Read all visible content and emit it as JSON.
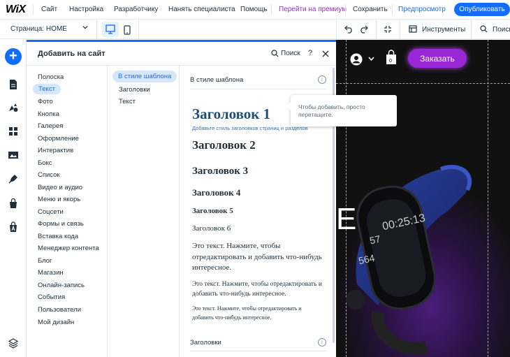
{
  "topbar": {
    "logo": "WiX",
    "nav": [
      "Сайт",
      "Настройка",
      "Разработчику",
      "Нанять специалиста",
      "Помощь"
    ],
    "premium": "Перейти на премиум",
    "save": "Сохранить",
    "preview": "Предпросмотр",
    "publish": "Опубликовать"
  },
  "toolbar2": {
    "page_selector": "Страница: HOME",
    "tools": "Инструменты",
    "search": "Поиск"
  },
  "panel": {
    "title": "Добавить на сайт",
    "search": "Поиск",
    "help": "?",
    "categories": [
      "Полоска",
      "Текст",
      "Фото",
      "Кнопка",
      "Галерея",
      "Оформление",
      "Интерактив",
      "Бокс",
      "Список",
      "Видео и аудио",
      "Меню и якорь",
      "Соцсети",
      "Формы и связь",
      "Вставка кода",
      "Менеджер контента",
      "Блог",
      "Магазин",
      "Онлайн-запись",
      "События",
      "Пользователи",
      "Мой дизайн"
    ],
    "active_category": "Текст",
    "subcategories": [
      "В стиле шаблона",
      "Заголовки",
      "Текст"
    ],
    "active_subcategory": "В стиле шаблона",
    "section_title": "В стиле шаблона",
    "headings": {
      "h1": "Заголовок 1",
      "h1_sub": "Добавьте стиль заголовков страниц и разделов",
      "h2": "Заголовок 2",
      "h3": "Заголовок 3",
      "h4": "Заголовок 4",
      "h5": "Заголовок 5",
      "h6": "Заголовок 6"
    },
    "paragraphs": {
      "p1": "Это текст. Нажмите, чтобы отредактировать и добавить что-нибудь интересное.",
      "p2": "Это текст. Нажмите, чтобы отредактировать и добавить что-нибудь интересное.",
      "p3": "Это текст. Нажмите, чтобы отредактировать и добавить что-нибудь интересное."
    },
    "section2_title": "Заголовки"
  },
  "tooltip": {
    "text": "Чтобы добавить, просто перетащите."
  },
  "canvas": {
    "order_button": "Заказать",
    "cart_count": "0",
    "watch_time": "00:25:13",
    "watch_hr": "57",
    "watch_steps": "564"
  },
  "colors": {
    "accent": "#116dff",
    "premium": "#9a27d5",
    "order": "#9a27d5"
  }
}
